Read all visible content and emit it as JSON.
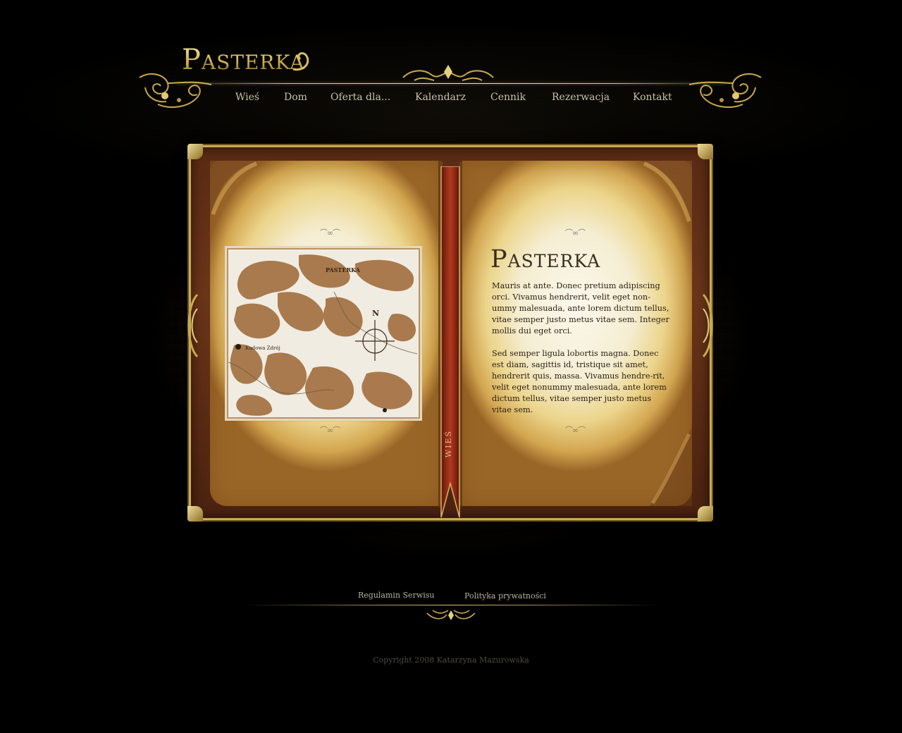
{
  "brand": {
    "logo": "Pasterka"
  },
  "nav": {
    "items": [
      {
        "label": "Wieś"
      },
      {
        "label": "Dom"
      },
      {
        "label": "Oferta dla..."
      },
      {
        "label": "Kalendarz"
      },
      {
        "label": "Cennik"
      },
      {
        "label": "Rezerwacja"
      },
      {
        "label": "Kontakt"
      }
    ]
  },
  "book": {
    "ribbon_label": "WIEŚ",
    "map": {
      "label_top": "PASTERKA",
      "label_town": "Kudowa Zdrój",
      "compass_label": "N"
    },
    "right_page": {
      "title": "Pasterka",
      "paragraphs": [
        "Mauris at ante. Donec pretium adipiscing orci. Vivamus hendrerit, velit eget non-ummy malesuada, ante lorem dictum tellus, vitae semper justo metus vitae sem. Integer mollis dui eget orci.",
        "Sed semper ligula lobortis magna. Donec est diam, sagittis id, tristique sit amet, hendrerit quis, massa. Vivamus hendre-rit, velit eget nonummy malesuada, ante lorem dictum tellus, vitae semper justo metus vitae sem."
      ]
    }
  },
  "footer": {
    "links": [
      {
        "label": "Regulamin Serwisu"
      },
      {
        "label": "Polityka prywatności"
      }
    ],
    "copyright": "Copyright 2008 Katarzyna Mazurowska"
  },
  "colors": {
    "background": "#000000",
    "gold": "#d8c27a",
    "nav_text": "#c9c2a4",
    "page_text": "#2a1d12",
    "cover_leather": "#5a2a14",
    "ribbon": "#a3301a",
    "map_land": "#a57446"
  },
  "icons": {
    "header_left": "gold-scroll-ornament-icon",
    "header_center": "gold-crest-ornament-icon",
    "header_right": "gold-scroll-ornament-icon",
    "compass": "compass-crosshair-icon",
    "footer_center": "gold-crest-ornament-icon"
  }
}
